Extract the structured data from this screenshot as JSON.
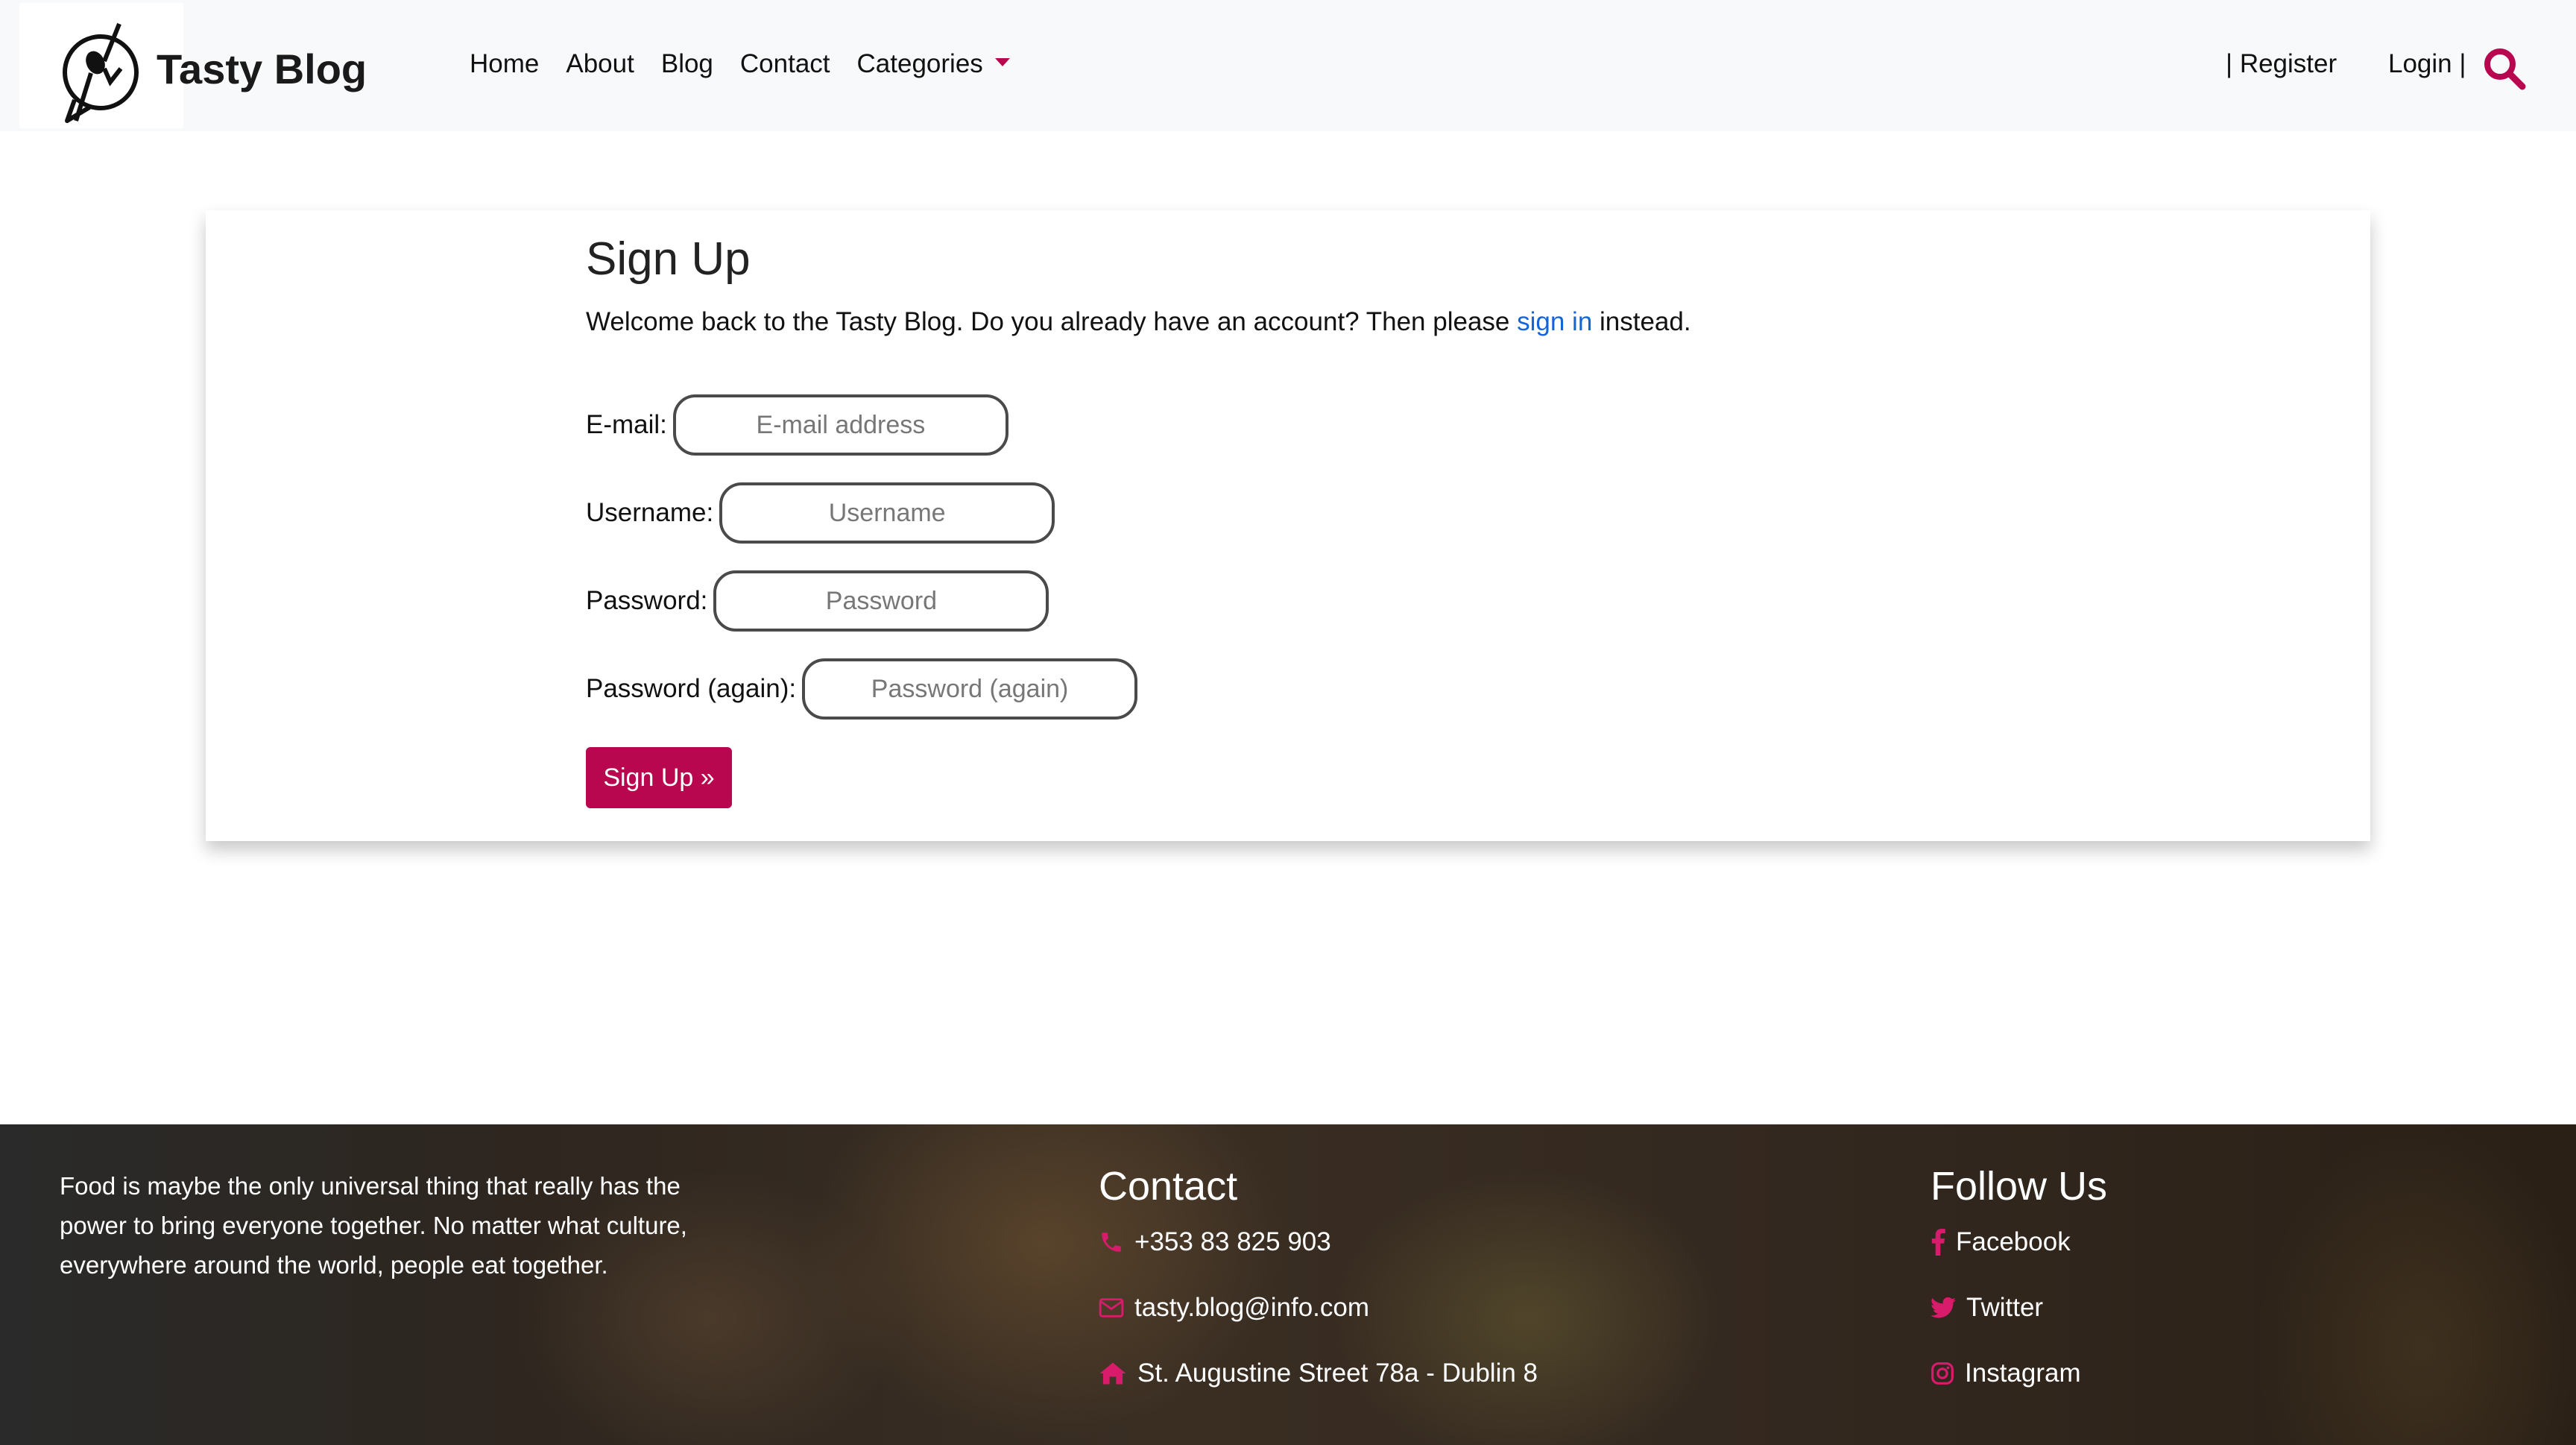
{
  "header": {
    "brand_name": "Tasty Blog",
    "nav": [
      "Home",
      "About",
      "Blog",
      "Contact"
    ],
    "categories_label": "Categories",
    "register_label": "| Register",
    "login_label": "Login |"
  },
  "signup": {
    "title": "Sign Up",
    "lead_text": "Welcome back to the Tasty Blog. Do you already have an account? Then please ",
    "lead_link": "sign in",
    "lead_suffix": " instead.",
    "fields": [
      {
        "label": "E-mail:",
        "placeholder": "E-mail address"
      },
      {
        "label": "Username:",
        "placeholder": "Username"
      },
      {
        "label": "Password:",
        "placeholder": "Password"
      },
      {
        "label": "Password (again):",
        "placeholder": "Password (again)"
      }
    ],
    "submit_label": "Sign Up »"
  },
  "footer": {
    "about": "Food is maybe the only universal thing that really has the power to bring everyone together. No matter what culture, everywhere around the world, people eat together.",
    "contact_heading": "Contact",
    "phone": "+353 83 825 903",
    "email": "tasty.blog@info.com",
    "address": "St. Augustine Street 78a - Dublin 8",
    "follow_heading": "Follow Us",
    "social": [
      "Facebook",
      "Twitter",
      "Instagram"
    ]
  },
  "colors": {
    "accent": "#b8064f",
    "link": "#1565d8",
    "navbar_bg": "#f8f9fa"
  },
  "icons": [
    "fork-spoon-logo-icon",
    "search-icon",
    "phone-icon",
    "envelope-icon",
    "home-icon",
    "facebook-icon",
    "twitter-icon",
    "instagram-icon"
  ]
}
